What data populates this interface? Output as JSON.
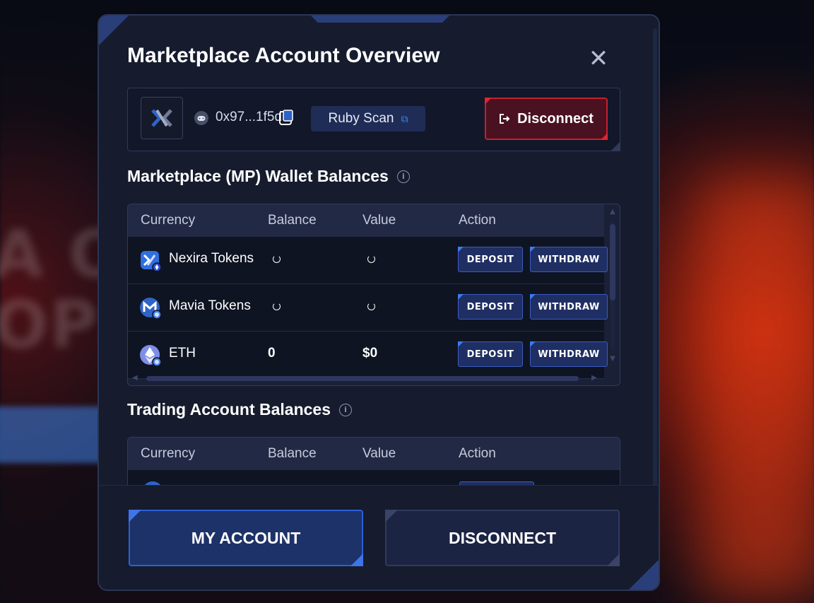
{
  "modal": {
    "title": "Marketplace Account Overview",
    "close_icon": "close-icon"
  },
  "account": {
    "address": "0x97...1f5d",
    "explorer_label": "Ruby Scan",
    "disconnect_label": "Disconnect"
  },
  "mp_wallet": {
    "title": "Marketplace (MP) Wallet Balances",
    "columns": [
      "Currency",
      "Balance",
      "Value",
      "Action"
    ],
    "rows": [
      {
        "currency": "Nexira Tokens",
        "icon": "nexira-token-icon",
        "balance": "",
        "value": "",
        "loading": true,
        "deposit": "DEPOSIT",
        "withdraw": "WITHDRAW"
      },
      {
        "currency": "Mavia Tokens",
        "icon": "mavia-token-icon",
        "balance": "",
        "value": "",
        "loading": true,
        "deposit": "DEPOSIT",
        "withdraw": "WITHDRAW"
      },
      {
        "currency": "ETH",
        "icon": "eth-icon",
        "balance": "0",
        "value": "$0",
        "loading": false,
        "deposit": "DEPOSIT",
        "withdraw": "WITHDRAW"
      }
    ]
  },
  "trading": {
    "title": "Trading Account Balances",
    "columns": [
      "Currency",
      "Balance",
      "Value",
      "Action"
    ]
  },
  "footer": {
    "my_account_label": "MY ACCOUNT",
    "disconnect_label": "DISCONNECT"
  },
  "colors": {
    "modal_bg": "#161c2e",
    "accent_blue": "#3f74e8",
    "danger_red": "#c5202c"
  }
}
